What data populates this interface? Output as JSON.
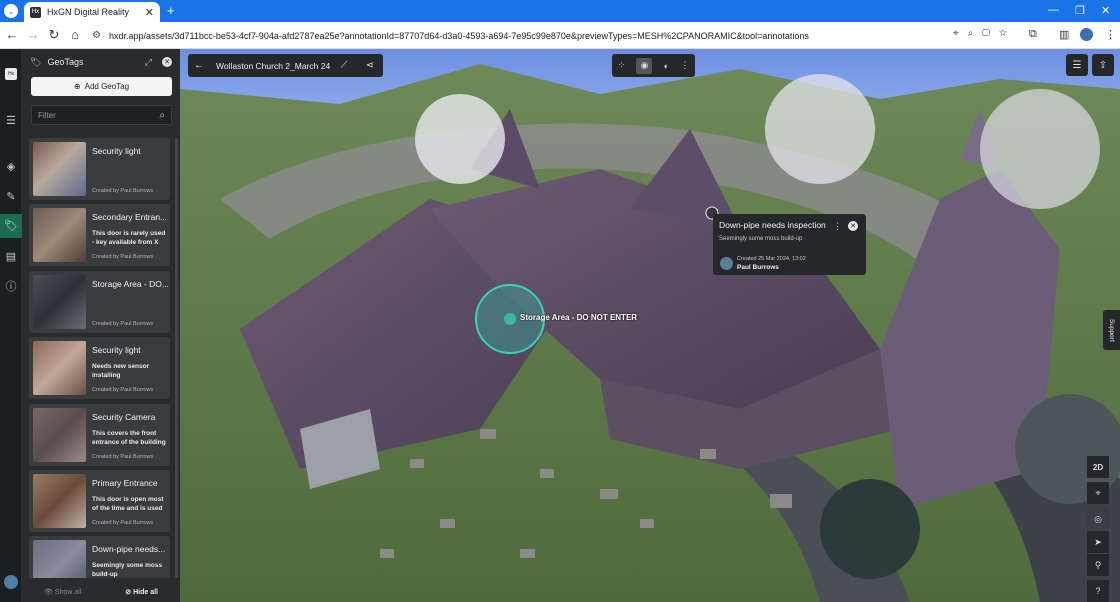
{
  "browser": {
    "tab_title": "HxGN Digital Reality",
    "url": "hxdr.app/assets/3d711bcc-be53-4cf7-904a-afd2787ea25e?annotationId=87707d64-d3a0-4593-a694-7e95c99e870e&previewTypes=MESH%2CPANORAMIC&tool=annotations"
  },
  "panel": {
    "title": "GeoTags",
    "add_label": "Add GeoTag",
    "filter_placeholder": "Filter",
    "show_all": "Show all",
    "hide_all": "Hide all",
    "cards": [
      {
        "title": "Security light",
        "desc": "",
        "by": "Created by Paul Burrows"
      },
      {
        "title": "Secondary Entran...",
        "desc": "This door is rarely used - key available from X",
        "by": "Created by Paul Burrows"
      },
      {
        "title": "Storage Area - DO...",
        "desc": "",
        "by": "Created by Paul Burrows"
      },
      {
        "title": "Security light",
        "desc": "Needs new sensor installing",
        "by": "Created by Paul Burrows"
      },
      {
        "title": "Security Camera",
        "desc": "This covers the front entrance of the building",
        "by": "Created by Paul Burrows"
      },
      {
        "title": "Primary Entrance",
        "desc": "This door is open most of the time and is used",
        "by": "Created by Paul Burrows"
      },
      {
        "title": "Down-pipe needs...",
        "desc": "Seemingly some moss build-up",
        "by": ""
      }
    ]
  },
  "viewer": {
    "asset_title": "Wollaston Church 2_March 24",
    "marker_label": "Storage Area - DO NOT ENTER",
    "view_mode": "2D",
    "support": "Support"
  },
  "popup": {
    "title": "Down-pipe needs inspection",
    "desc": "Seemingly some moss build-up",
    "created": "Created 25 Mar 2024, 13:02",
    "author": "Paul Burrows"
  },
  "colors": {
    "accent": "#1d6b52",
    "marker": "#2ec4a8",
    "browser_blue": "#1a73e8"
  }
}
